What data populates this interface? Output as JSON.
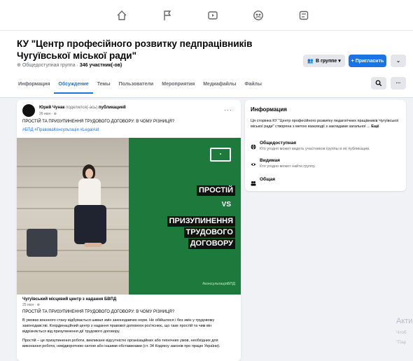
{
  "header": {
    "title": "КУ \"Центр професійного розвитку педпрацівників Чугуївської міської ради\"",
    "privacy": "Общедоступная группа",
    "members": "346 участник(-ов)",
    "in_group_label": "В группе ▾",
    "invite_label": "+ Пригласить",
    "more_label": "⌄"
  },
  "tabs": [
    {
      "label": "Информация"
    },
    {
      "label": "Обсуждение"
    },
    {
      "label": "Темы"
    },
    {
      "label": "Пользователи"
    },
    {
      "label": "Мероприятия"
    },
    {
      "label": "Медиафайлы"
    },
    {
      "label": "Файлы"
    }
  ],
  "post": {
    "author": "Юрий Чунак",
    "action": "поделился(-ась)",
    "object": "публикацией",
    "date": "26 июн · ⊕",
    "text": "ПРОСТІЙ ТА ПРИЗУПИНЕННЯ ТРУДОВОГО ДОГОВОРУ: В ЧОМУ РІЗНИЦЯ?",
    "tags": "#БПД #ПравоваКонсультація #LegalAid",
    "image": {
      "line1": "ПРОСТІЙ",
      "vs": "VS",
      "line2": "ПРИЗУПИНЕННЯ",
      "line3": "ТРУДОВОГО",
      "line4": "ДОГОВОРУ",
      "hashtag": "#консультаціяБПД"
    },
    "share": {
      "source": "Чугуївський місцевий центр з надання БВПД",
      "date": "25 июн · ⊕",
      "title": "ПРОСТІЙ ТА ПРИЗУПИНЕННЯ ТРУДОВОГО ДОГОВОРУ: В ЧОМУ РІЗНИЦЯ?",
      "p1": "В умовах воєнного стану відбувається шквал змін законодавчих норм. Не обійшлося і без змін у трудовому законодавстві. Координаційний центр з надання правової допомоги роз'яснює, що таке простій та чим він відрізняється від призупинення дії трудового договору.",
      "p2": "Простій – це призупинення роботи, викликане відсутністю організаційних або технічних умов, необхідних для виконання роботи, невідворотною силою або іншими обставинами (ст. 34 Кодексу законів про працю України)."
    }
  },
  "info": {
    "title": "Информация",
    "desc": "Ця сторінка КУ \"Центр професійного розвитку педагогічних працівників Чугуївської міської ради\" створена з метою взаємодії з закладами загальної ...",
    "more": "Ещё",
    "items": [
      {
        "label": "Общедоступная",
        "sub": "Кто угодно может видеть участников группы и их публикации."
      },
      {
        "label": "Видимая",
        "sub": "Кто угодно может найти группу."
      },
      {
        "label": "Общая",
        "sub": ""
      }
    ]
  },
  "watermark": {
    "line1": "Акти",
    "line2": "Чтоб",
    "line3": "\"Пар"
  }
}
